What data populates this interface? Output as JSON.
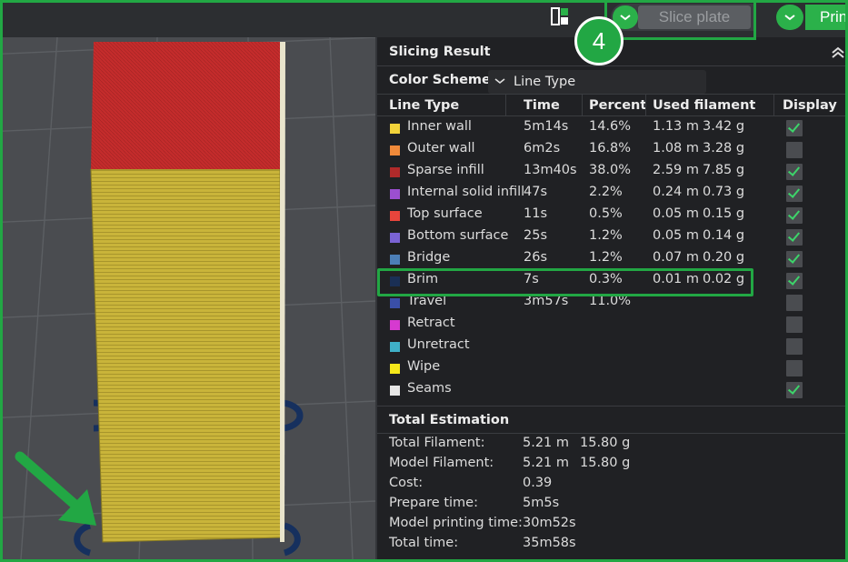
{
  "toolbar": {
    "slice_label": "Slice plate",
    "print_label": "Prin",
    "step_badge": "4",
    "icons": [
      "layout-icon",
      "chevron-down-icon"
    ]
  },
  "panel": {
    "title": "Slicing Result",
    "color_scheme_label": "Color Scheme",
    "color_scheme_value": "Line Type",
    "headers": {
      "line_type": "Line Type",
      "time": "Time",
      "percent": "Percent",
      "used_filament": "Used filament",
      "display": "Display"
    },
    "rows": [
      {
        "name": "Inner wall",
        "color": "#f2d33a",
        "time": "5m14s",
        "percent": "14.6%",
        "length": "1.13 m",
        "weight": "3.42 g",
        "display": true
      },
      {
        "name": "Outer wall",
        "color": "#f08a3a",
        "time": "6m2s",
        "percent": "16.8%",
        "length": "1.08 m",
        "weight": "3.28 g",
        "display": false
      },
      {
        "name": "Sparse infill",
        "color": "#b02a2a",
        "time": "13m40s",
        "percent": "38.0%",
        "length": "2.59 m",
        "weight": "7.85 g",
        "display": true
      },
      {
        "name": "Internal solid infill",
        "color": "#9b4fd0",
        "time": "47s",
        "percent": "2.2%",
        "length": "0.24 m",
        "weight": "0.73 g",
        "display": true
      },
      {
        "name": "Top surface",
        "color": "#e8453c",
        "time": "11s",
        "percent": "0.5%",
        "length": "0.05 m",
        "weight": "0.15 g",
        "display": true
      },
      {
        "name": "Bottom surface",
        "color": "#7a63d4",
        "time": "25s",
        "percent": "1.2%",
        "length": "0.05 m",
        "weight": "0.14 g",
        "display": true
      },
      {
        "name": "Bridge",
        "color": "#4c7fb8",
        "time": "26s",
        "percent": "1.2%",
        "length": "0.07 m",
        "weight": "0.20 g",
        "display": true
      },
      {
        "name": "Brim",
        "color": "#1a2f55",
        "time": "7s",
        "percent": "0.3%",
        "length": "0.01 m",
        "weight": "0.02 g",
        "display": true
      },
      {
        "name": "Travel",
        "color": "#3a4fa8",
        "time": "3m57s",
        "percent": "11.0%",
        "length": "",
        "weight": "",
        "display": false
      },
      {
        "name": "Retract",
        "color": "#d63ad0",
        "time": "",
        "percent": "",
        "length": "",
        "weight": "",
        "display": false
      },
      {
        "name": "Unretract",
        "color": "#3fb0c8",
        "time": "",
        "percent": "",
        "length": "",
        "weight": "",
        "display": false
      },
      {
        "name": "Wipe",
        "color": "#f5e81a",
        "time": "",
        "percent": "",
        "length": "",
        "weight": "",
        "display": false
      },
      {
        "name": "Seams",
        "color": "#e6e6e6",
        "time": "",
        "percent": "",
        "length": "",
        "weight": "",
        "display": true
      }
    ],
    "total_title": "Total Estimation",
    "estimates": [
      {
        "label": "Total Filament:",
        "v1": "5.21 m",
        "v2": "15.80 g"
      },
      {
        "label": "Model Filament:",
        "v1": "5.21 m",
        "v2": "15.80 g"
      },
      {
        "label": "Cost:",
        "v1": "0.39",
        "v2": ""
      },
      {
        "label": "Prepare time:",
        "v1": "5m5s",
        "v2": ""
      },
      {
        "label": "Model printing time:",
        "v1": "30m52s",
        "v2": ""
      },
      {
        "label": "Total time:",
        "v1": "35m58s",
        "v2": ""
      }
    ]
  }
}
